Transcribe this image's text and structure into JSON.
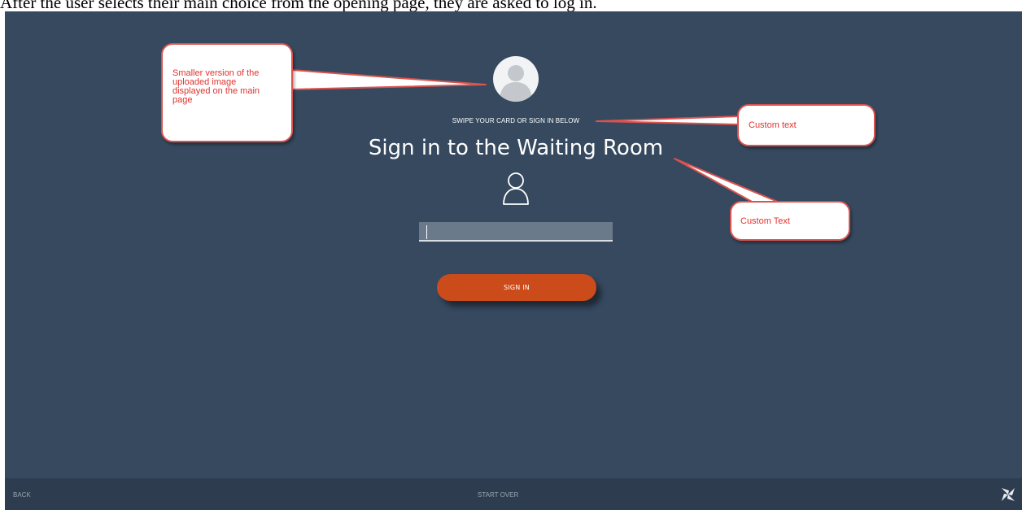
{
  "caption": "After the user selects their main choice from the opening page, they are asked to log in.",
  "screen": {
    "swipe_text": "SWIPE YOUR CARD OR SIGN IN BELOW",
    "title": "Sign in to the Waiting Room",
    "input_value": "",
    "signin_button": "SIGN IN",
    "colors": {
      "background": "#36495f",
      "footer": "#2d3d4f",
      "button": "#cc4b1b",
      "input": "#6b7a8b"
    }
  },
  "footer": {
    "back": "BACK",
    "start_over": "START OVER",
    "logo_icon": "pinwheel-logo-icon"
  },
  "annotations": {
    "image_note": [
      "Smaller version of the",
      "uploaded image",
      "displayed on the main",
      "page"
    ],
    "custom_text_1": "Custom text",
    "custom_text_2": "Custom Text",
    "color": "#d9534f"
  }
}
